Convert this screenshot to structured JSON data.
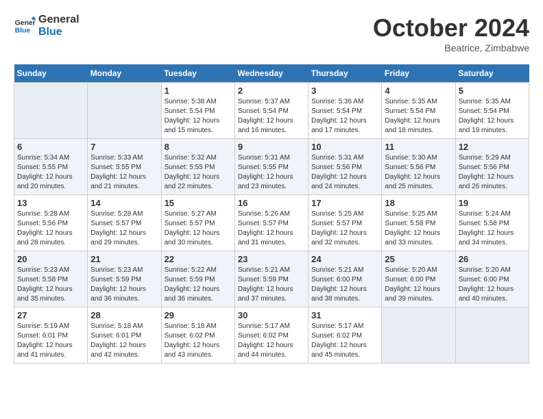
{
  "header": {
    "logo_line1": "General",
    "logo_line2": "Blue",
    "month_title": "October 2024",
    "location": "Beatrice, Zimbabwe"
  },
  "weekdays": [
    "Sunday",
    "Monday",
    "Tuesday",
    "Wednesday",
    "Thursday",
    "Friday",
    "Saturday"
  ],
  "weeks": [
    [
      {
        "day": "",
        "sunrise": "",
        "sunset": "",
        "daylight": ""
      },
      {
        "day": "",
        "sunrise": "",
        "sunset": "",
        "daylight": ""
      },
      {
        "day": "1",
        "sunrise": "Sunrise: 5:38 AM",
        "sunset": "Sunset: 5:54 PM",
        "daylight": "Daylight: 12 hours and 15 minutes."
      },
      {
        "day": "2",
        "sunrise": "Sunrise: 5:37 AM",
        "sunset": "Sunset: 5:54 PM",
        "daylight": "Daylight: 12 hours and 16 minutes."
      },
      {
        "day": "3",
        "sunrise": "Sunrise: 5:36 AM",
        "sunset": "Sunset: 5:54 PM",
        "daylight": "Daylight: 12 hours and 17 minutes."
      },
      {
        "day": "4",
        "sunrise": "Sunrise: 5:35 AM",
        "sunset": "Sunset: 5:54 PM",
        "daylight": "Daylight: 12 hours and 18 minutes."
      },
      {
        "day": "5",
        "sunrise": "Sunrise: 5:35 AM",
        "sunset": "Sunset: 5:54 PM",
        "daylight": "Daylight: 12 hours and 19 minutes."
      }
    ],
    [
      {
        "day": "6",
        "sunrise": "Sunrise: 5:34 AM",
        "sunset": "Sunset: 5:55 PM",
        "daylight": "Daylight: 12 hours and 20 minutes."
      },
      {
        "day": "7",
        "sunrise": "Sunrise: 5:33 AM",
        "sunset": "Sunset: 5:55 PM",
        "daylight": "Daylight: 12 hours and 21 minutes."
      },
      {
        "day": "8",
        "sunrise": "Sunrise: 5:32 AM",
        "sunset": "Sunset: 5:55 PM",
        "daylight": "Daylight: 12 hours and 22 minutes."
      },
      {
        "day": "9",
        "sunrise": "Sunrise: 5:31 AM",
        "sunset": "Sunset: 5:55 PM",
        "daylight": "Daylight: 12 hours and 23 minutes."
      },
      {
        "day": "10",
        "sunrise": "Sunrise: 5:31 AM",
        "sunset": "Sunset: 5:56 PM",
        "daylight": "Daylight: 12 hours and 24 minutes."
      },
      {
        "day": "11",
        "sunrise": "Sunrise: 5:30 AM",
        "sunset": "Sunset: 5:56 PM",
        "daylight": "Daylight: 12 hours and 25 minutes."
      },
      {
        "day": "12",
        "sunrise": "Sunrise: 5:29 AM",
        "sunset": "Sunset: 5:56 PM",
        "daylight": "Daylight: 12 hours and 26 minutes."
      }
    ],
    [
      {
        "day": "13",
        "sunrise": "Sunrise: 5:28 AM",
        "sunset": "Sunset: 5:56 PM",
        "daylight": "Daylight: 12 hours and 28 minutes."
      },
      {
        "day": "14",
        "sunrise": "Sunrise: 5:28 AM",
        "sunset": "Sunset: 5:57 PM",
        "daylight": "Daylight: 12 hours and 29 minutes."
      },
      {
        "day": "15",
        "sunrise": "Sunrise: 5:27 AM",
        "sunset": "Sunset: 5:57 PM",
        "daylight": "Daylight: 12 hours and 30 minutes."
      },
      {
        "day": "16",
        "sunrise": "Sunrise: 5:26 AM",
        "sunset": "Sunset: 5:57 PM",
        "daylight": "Daylight: 12 hours and 31 minutes."
      },
      {
        "day": "17",
        "sunrise": "Sunrise: 5:25 AM",
        "sunset": "Sunset: 5:57 PM",
        "daylight": "Daylight: 12 hours and 32 minutes."
      },
      {
        "day": "18",
        "sunrise": "Sunrise: 5:25 AM",
        "sunset": "Sunset: 5:58 PM",
        "daylight": "Daylight: 12 hours and 33 minutes."
      },
      {
        "day": "19",
        "sunrise": "Sunrise: 5:24 AM",
        "sunset": "Sunset: 5:58 PM",
        "daylight": "Daylight: 12 hours and 34 minutes."
      }
    ],
    [
      {
        "day": "20",
        "sunrise": "Sunrise: 5:23 AM",
        "sunset": "Sunset: 5:58 PM",
        "daylight": "Daylight: 12 hours and 35 minutes."
      },
      {
        "day": "21",
        "sunrise": "Sunrise: 5:23 AM",
        "sunset": "Sunset: 5:59 PM",
        "daylight": "Daylight: 12 hours and 36 minutes."
      },
      {
        "day": "22",
        "sunrise": "Sunrise: 5:22 AM",
        "sunset": "Sunset: 5:59 PM",
        "daylight": "Daylight: 12 hours and 36 minutes."
      },
      {
        "day": "23",
        "sunrise": "Sunrise: 5:21 AM",
        "sunset": "Sunset: 5:59 PM",
        "daylight": "Daylight: 12 hours and 37 minutes."
      },
      {
        "day": "24",
        "sunrise": "Sunrise: 5:21 AM",
        "sunset": "Sunset: 6:00 PM",
        "daylight": "Daylight: 12 hours and 38 minutes."
      },
      {
        "day": "25",
        "sunrise": "Sunrise: 5:20 AM",
        "sunset": "Sunset: 6:00 PM",
        "daylight": "Daylight: 12 hours and 39 minutes."
      },
      {
        "day": "26",
        "sunrise": "Sunrise: 5:20 AM",
        "sunset": "Sunset: 6:00 PM",
        "daylight": "Daylight: 12 hours and 40 minutes."
      }
    ],
    [
      {
        "day": "27",
        "sunrise": "Sunrise: 5:19 AM",
        "sunset": "Sunset: 6:01 PM",
        "daylight": "Daylight: 12 hours and 41 minutes."
      },
      {
        "day": "28",
        "sunrise": "Sunrise: 5:18 AM",
        "sunset": "Sunset: 6:01 PM",
        "daylight": "Daylight: 12 hours and 42 minutes."
      },
      {
        "day": "29",
        "sunrise": "Sunrise: 5:18 AM",
        "sunset": "Sunset: 6:02 PM",
        "daylight": "Daylight: 12 hours and 43 minutes."
      },
      {
        "day": "30",
        "sunrise": "Sunrise: 5:17 AM",
        "sunset": "Sunset: 6:02 PM",
        "daylight": "Daylight: 12 hours and 44 minutes."
      },
      {
        "day": "31",
        "sunrise": "Sunrise: 5:17 AM",
        "sunset": "Sunset: 6:02 PM",
        "daylight": "Daylight: 12 hours and 45 minutes."
      },
      {
        "day": "",
        "sunrise": "",
        "sunset": "",
        "daylight": ""
      },
      {
        "day": "",
        "sunrise": "",
        "sunset": "",
        "daylight": ""
      }
    ]
  ]
}
